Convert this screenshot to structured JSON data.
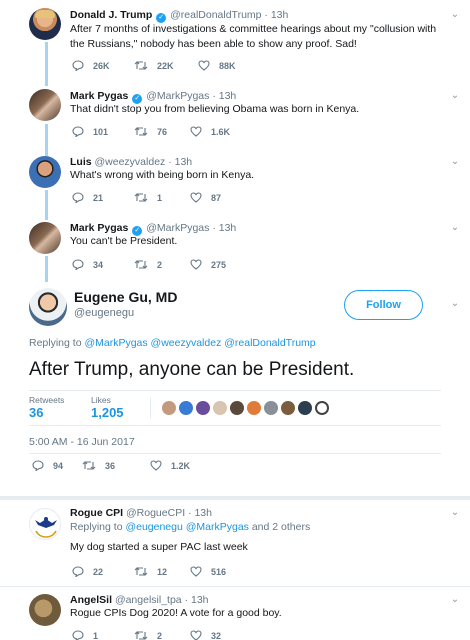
{
  "tweets": [
    {
      "name": "Donald J. Trump",
      "handle": "@realDonaldTrump",
      "time": "· 13h",
      "text": "After 7 months of investigations & committee hearings about my \"collusion with the Russians,\"  nobody has been able to show any proof. Sad!",
      "replies": "26K",
      "retweets": "22K",
      "likes": "88K",
      "verified": true
    },
    {
      "name": "Mark Pygas",
      "handle": "@MarkPygas",
      "time": "· 13h",
      "text": "That didn't stop you from believing Obama was born in Kenya.",
      "replies": "101",
      "retweets": "76",
      "likes": "1.6K",
      "verified": true
    },
    {
      "name": "Luis",
      "handle": "@weezyvaldez",
      "time": "· 13h",
      "text": "What's wrong with being born in Kenya.",
      "replies": "21",
      "retweets": "1",
      "likes": "87",
      "verified": false
    },
    {
      "name": "Mark Pygas",
      "handle": "@MarkPygas",
      "time": "· 13h",
      "text": "You can't be President.",
      "replies": "34",
      "retweets": "2",
      "likes": "275",
      "verified": true
    }
  ],
  "main": {
    "name": "Eugene Gu, MD",
    "handle": "@eugenegu",
    "follow_label": "Follow",
    "replying_prefix": "Replying to",
    "replying_to": "@MarkPygas @weezyvaldez @realDonaldTrump",
    "text": "After Trump, anyone can be President.",
    "retweets_label": "Retweets",
    "retweets": "36",
    "likes_label": "Likes",
    "likes": "1,205",
    "timestamp": "5:00 AM - 16 Jun 2017",
    "replies_count": "94",
    "retweets_count": "36",
    "likes_count": "1.2K"
  },
  "replies": [
    {
      "name": "Rogue CPI",
      "handle": "@RogueCPI",
      "time": "· 13h",
      "replying_prefix": "Replying to",
      "replying_to": "@eugenegu @MarkPygas",
      "replying_suffix": "and 2 others",
      "text": "My dog started a super PAC last week",
      "replies": "22",
      "retweets": "12",
      "likes": "516"
    },
    {
      "name": "AngelSil",
      "handle": "@angelsil_tpa",
      "time": "· 13h",
      "text": "Rogue CPIs Dog 2020! A vote for a good boy.",
      "replies": "1",
      "retweets": "2",
      "likes": "32"
    }
  ],
  "colors": {
    "accent": "#1da1f2",
    "link": "#1b95e0",
    "muted": "#657786",
    "thread": "#a6d3f2"
  }
}
